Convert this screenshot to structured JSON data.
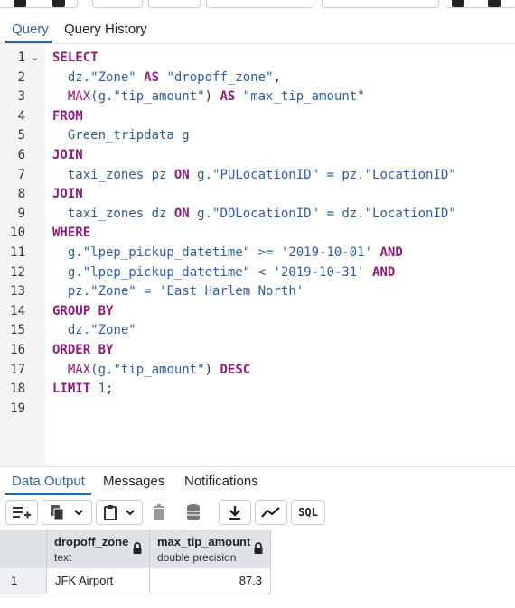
{
  "query_tabs": [
    {
      "label": "Query"
    },
    {
      "label": "Query History"
    }
  ],
  "editor": {
    "line_numbers": [
      "1",
      "2",
      "3",
      "4",
      "5",
      "6",
      "7",
      "8",
      "9",
      "10",
      "11",
      "12",
      "13",
      "14",
      "15",
      "16",
      "17",
      "18",
      "19"
    ],
    "lines": [
      [
        {
          "t": "SELECT",
          "k": "kw"
        }
      ],
      [
        {
          "t": "  dz.",
          "k": "id"
        },
        {
          "t": "\"Zone\"",
          "k": "str"
        },
        {
          "t": " AS ",
          "k": "kw"
        },
        {
          "t": "\"dropoff_zone\"",
          "k": "str"
        },
        {
          "t": ",",
          "k": "pun"
        }
      ],
      [
        {
          "t": "  MAX",
          "k": "fn"
        },
        {
          "t": "(g.",
          "k": "id"
        },
        {
          "t": "\"tip_amount\"",
          "k": "str"
        },
        {
          "t": ")",
          "k": "pun"
        },
        {
          "t": " AS ",
          "k": "kw"
        },
        {
          "t": "\"max_tip_amount\"",
          "k": "str"
        }
      ],
      [
        {
          "t": "FROM",
          "k": "kw"
        }
      ],
      [
        {
          "t": "  Green_tripdata g",
          "k": "id"
        }
      ],
      [
        {
          "t": "JOIN",
          "k": "kw"
        }
      ],
      [
        {
          "t": "  taxi_zones pz ",
          "k": "id"
        },
        {
          "t": "ON",
          "k": "kw"
        },
        {
          "t": " g.",
          "k": "id"
        },
        {
          "t": "\"PULocationID\"",
          "k": "str"
        },
        {
          "t": " = pz.",
          "k": "id"
        },
        {
          "t": "\"LocationID\"",
          "k": "str"
        }
      ],
      [
        {
          "t": "JOIN",
          "k": "kw"
        }
      ],
      [
        {
          "t": "  taxi_zones dz ",
          "k": "id"
        },
        {
          "t": "ON",
          "k": "kw"
        },
        {
          "t": " g.",
          "k": "id"
        },
        {
          "t": "\"DOLocationID\"",
          "k": "str"
        },
        {
          "t": " = dz.",
          "k": "id"
        },
        {
          "t": "\"LocationID\"",
          "k": "str"
        }
      ],
      [
        {
          "t": "WHERE",
          "k": "kw"
        }
      ],
      [
        {
          "t": "  g.",
          "k": "id"
        },
        {
          "t": "\"lpep_pickup_datetime\"",
          "k": "str"
        },
        {
          "t": " >= ",
          "k": "id"
        },
        {
          "t": "'2019-10-01'",
          "k": "str"
        },
        {
          "t": " AND",
          "k": "kw"
        }
      ],
      [
        {
          "t": "  g.",
          "k": "id"
        },
        {
          "t": "\"lpep_pickup_datetime\"",
          "k": "str"
        },
        {
          "t": " < ",
          "k": "id"
        },
        {
          "t": "'2019-10-31'",
          "k": "str"
        },
        {
          "t": " AND",
          "k": "kw"
        }
      ],
      [
        {
          "t": "  pz.",
          "k": "id"
        },
        {
          "t": "\"Zone\"",
          "k": "str"
        },
        {
          "t": " = ",
          "k": "id"
        },
        {
          "t": "'East Harlem North'",
          "k": "str"
        }
      ],
      [
        {
          "t": "GROUP BY",
          "k": "kw"
        }
      ],
      [
        {
          "t": "  dz.",
          "k": "id"
        },
        {
          "t": "\"Zone\"",
          "k": "str"
        }
      ],
      [
        {
          "t": "ORDER BY",
          "k": "kw"
        }
      ],
      [
        {
          "t": "  MAX",
          "k": "fn"
        },
        {
          "t": "(g.",
          "k": "id"
        },
        {
          "t": "\"tip_amount\"",
          "k": "str"
        },
        {
          "t": ")",
          "k": "pun"
        },
        {
          "t": " DESC",
          "k": "kw"
        }
      ],
      [
        {
          "t": "LIMIT ",
          "k": "kw"
        },
        {
          "t": "1",
          "k": "num"
        },
        {
          "t": ";",
          "k": "pun"
        }
      ],
      []
    ]
  },
  "result_tabs": [
    {
      "label": "Data Output"
    },
    {
      "label": "Messages"
    },
    {
      "label": "Notifications"
    }
  ],
  "result_toolbar": {
    "sql_label": "SQL"
  },
  "grid": {
    "columns": [
      {
        "name": "dropoff_zone",
        "type": "text"
      },
      {
        "name": "max_tip_amount",
        "type": "double precision"
      }
    ],
    "rows": [
      {
        "num": "1",
        "cells": [
          "JFK Airport",
          "87.3"
        ]
      }
    ]
  },
  "colors": {
    "accent": "#326690",
    "keyword": "#8e1c7c",
    "string": "#2b5fa8",
    "header_bg": "#dfe3e8"
  }
}
